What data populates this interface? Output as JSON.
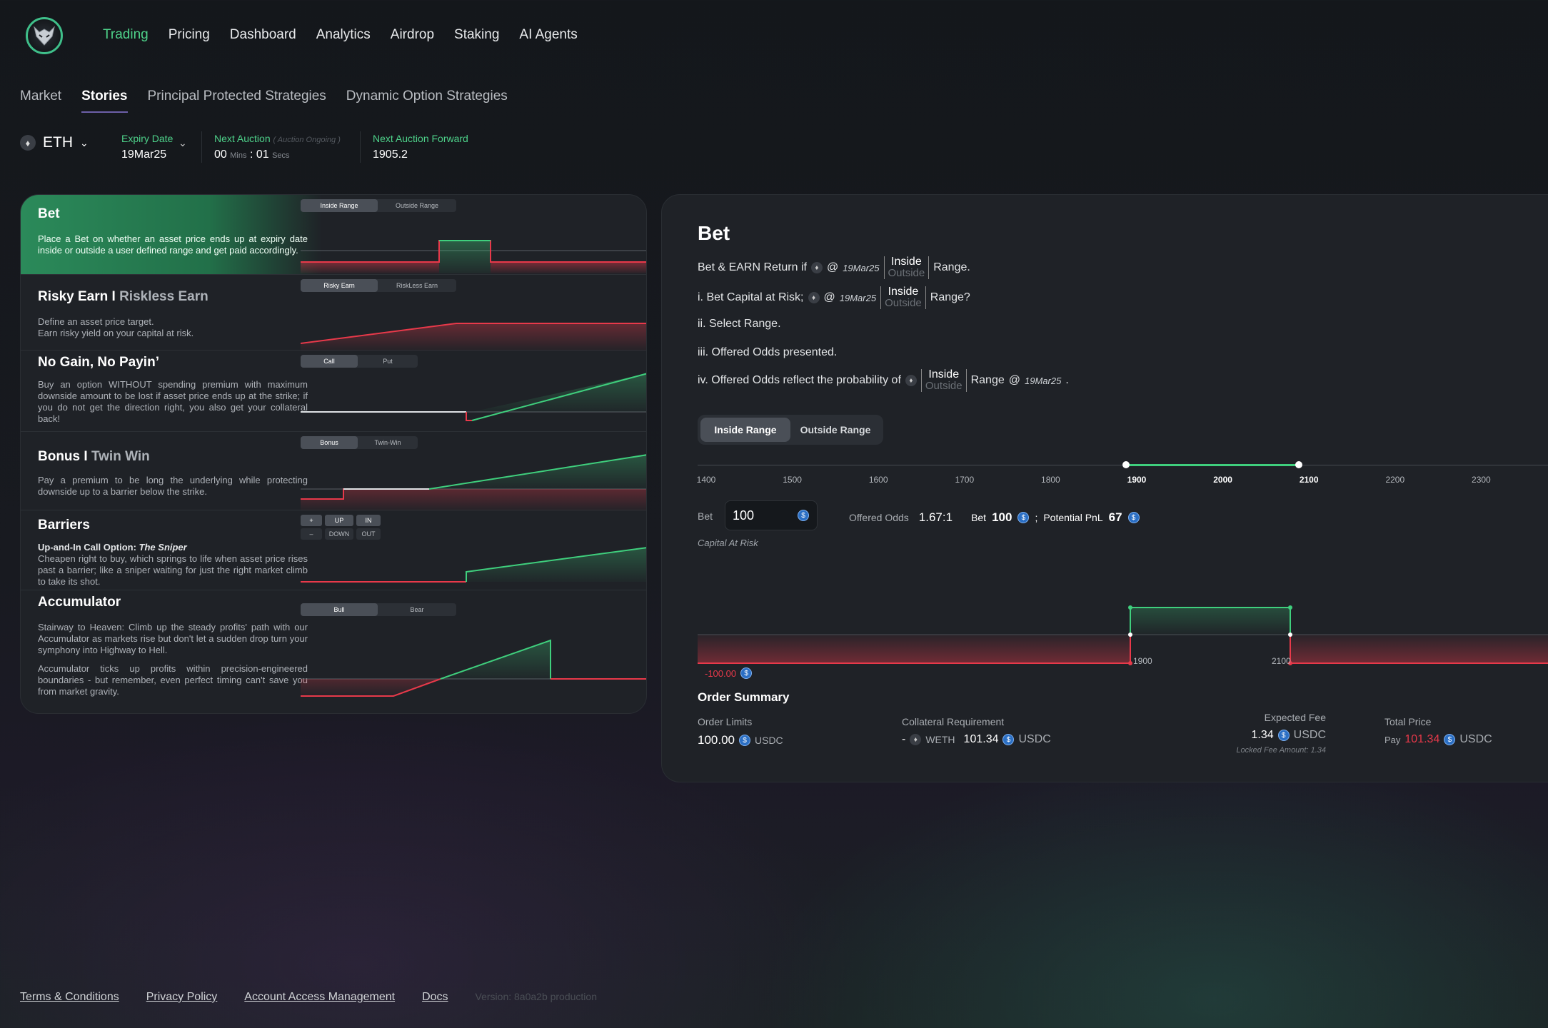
{
  "nav": {
    "items": [
      "Trading",
      "Pricing",
      "Dashboard",
      "Analytics",
      "Airdrop",
      "Staking",
      "AI Agents"
    ],
    "active": "Trading"
  },
  "subnav": {
    "items": [
      "Market",
      "Stories",
      "Principal Protected Strategies",
      "Dynamic Option Strategies"
    ],
    "active": "Stories"
  },
  "asset": {
    "symbol": "ETH",
    "icon": "eth-icon"
  },
  "expiry": {
    "label": "Expiry Date",
    "value": "19Mar25"
  },
  "auction": {
    "label": "Next Auction",
    "status": "( Auction Ongoing )",
    "mins": "00",
    "mins_unit": "Mins",
    "sep": ":",
    "secs": "01",
    "secs_unit": "Secs"
  },
  "forward": {
    "label": "Next Auction Forward",
    "value": "1905.2"
  },
  "strategies": {
    "bet": {
      "title": "Bet",
      "desc": "Place a Bet on whether an asset price ends up at expiry date inside or outside a user defined range and get paid accordingly.",
      "toggle": [
        "Inside Range",
        "Outside Range"
      ]
    },
    "risky": {
      "title_a": "Risky Earn I",
      "title_b": "Riskless Earn",
      "desc": "Define an asset price target.\nEarn risky yield on your capital at risk.",
      "toggle": [
        "Risky Earn",
        "RiskLess Earn"
      ]
    },
    "nogain": {
      "title": "No Gain, No Payin’",
      "desc": "Buy an option WITHOUT spending premium with maximum downside amount to be lost if asset price ends up at the strike; if you do not get the direction right, you also get your collateral back!",
      "toggle": [
        "Call",
        "Put"
      ]
    },
    "bonus": {
      "title_a": "Bonus I",
      "title_b": "Twin Win",
      "desc": "Pay a premium to be long the underlying while protecting downside up to a barrier below the strike.",
      "toggle": [
        "Bonus",
        "Twin-Win"
      ]
    },
    "barriers": {
      "title": "Barriers",
      "subtitle": "Up-and-In Call Option:",
      "subtitle_name": "The Sniper",
      "desc": "Cheapen right to buy, which springs to life when asset price rises past a barrier; like a sniper waiting for just the right market climb to take its shot.",
      "buttons": [
        "+",
        "UP",
        "IN",
        "–",
        "DOWN",
        "OUT"
      ]
    },
    "accumulator": {
      "title": "Accumulator",
      "desc1": "Stairway to Heaven: Climb up the steady profits' path with our Accumulator as markets rise but don't let a sudden drop turn your symphony into Highway to Hell.",
      "desc2": "Accumulator ticks up profits within precision-engineered boundaries - but remember, even perfect timing can't save you from market gravity.",
      "toggle": [
        "Bull",
        "Bear"
      ]
    }
  },
  "bet_panel": {
    "title": "Bet",
    "line1_prefix": "Bet & EARN Return if",
    "at": "@",
    "date": "19Mar25",
    "inside": "Inside",
    "outside": "Outside",
    "line1_suffix": "Range.",
    "line2_prefix": "i. Bet Capital at Risk;",
    "line2_suffix": "Range?",
    "line3": "ii. Select Range.",
    "line4": "iii. Offered Odds presented.",
    "line5_prefix": "iv. Offered Odds reflect the probability of",
    "line5_mid": "Range",
    "line5_end": ".",
    "range_toggle": [
      "Inside Range",
      "Outside Range"
    ],
    "axis_ticks": [
      "1400",
      "1500",
      "1600",
      "1700",
      "1800",
      "1900",
      "2000",
      "2100",
      "2200",
      "2300"
    ],
    "range_low": 1900,
    "range_high": 2100,
    "bet_label": "Bet",
    "bet_value": "100",
    "odds_label": "Offered Odds",
    "odds_value": "1.67:1",
    "bet_summary_label": "Bet",
    "bet_summary_value": "100",
    "pnl_label": "Potential PnL",
    "pnl_value": "67",
    "capital_label": "Capital At Risk",
    "payoff_loss": "-100.00",
    "payoff_x1": "1900",
    "payoff_x2": "2100"
  },
  "order": {
    "title": "Order Summary",
    "limits_label": "Order Limits",
    "limits_value": "100.00",
    "limits_unit": "USDC",
    "collateral_label": "Collateral Requirement",
    "collateral_dash": "-",
    "collateral_weth": "WETH",
    "collateral_value": "101.34",
    "collateral_unit": "USDC",
    "fee_label": "Expected Fee",
    "fee_value": "1.34",
    "fee_unit": "USDC",
    "fee_locked": "Locked Fee Amount: 1.34",
    "total_label": "Total Price",
    "total_pay": "Pay",
    "total_value": "101.34",
    "total_unit": "USDC"
  },
  "footer": {
    "links": [
      "Terms & Conditions",
      "Privacy Policy",
      "Account Access Management",
      "Docs"
    ],
    "version": "Version: 8a0a2b production"
  },
  "colors": {
    "accent": "#4ed28a",
    "loss": "#e8394a",
    "gain": "#3fcf7d",
    "usdc": "#2b6fc4"
  }
}
